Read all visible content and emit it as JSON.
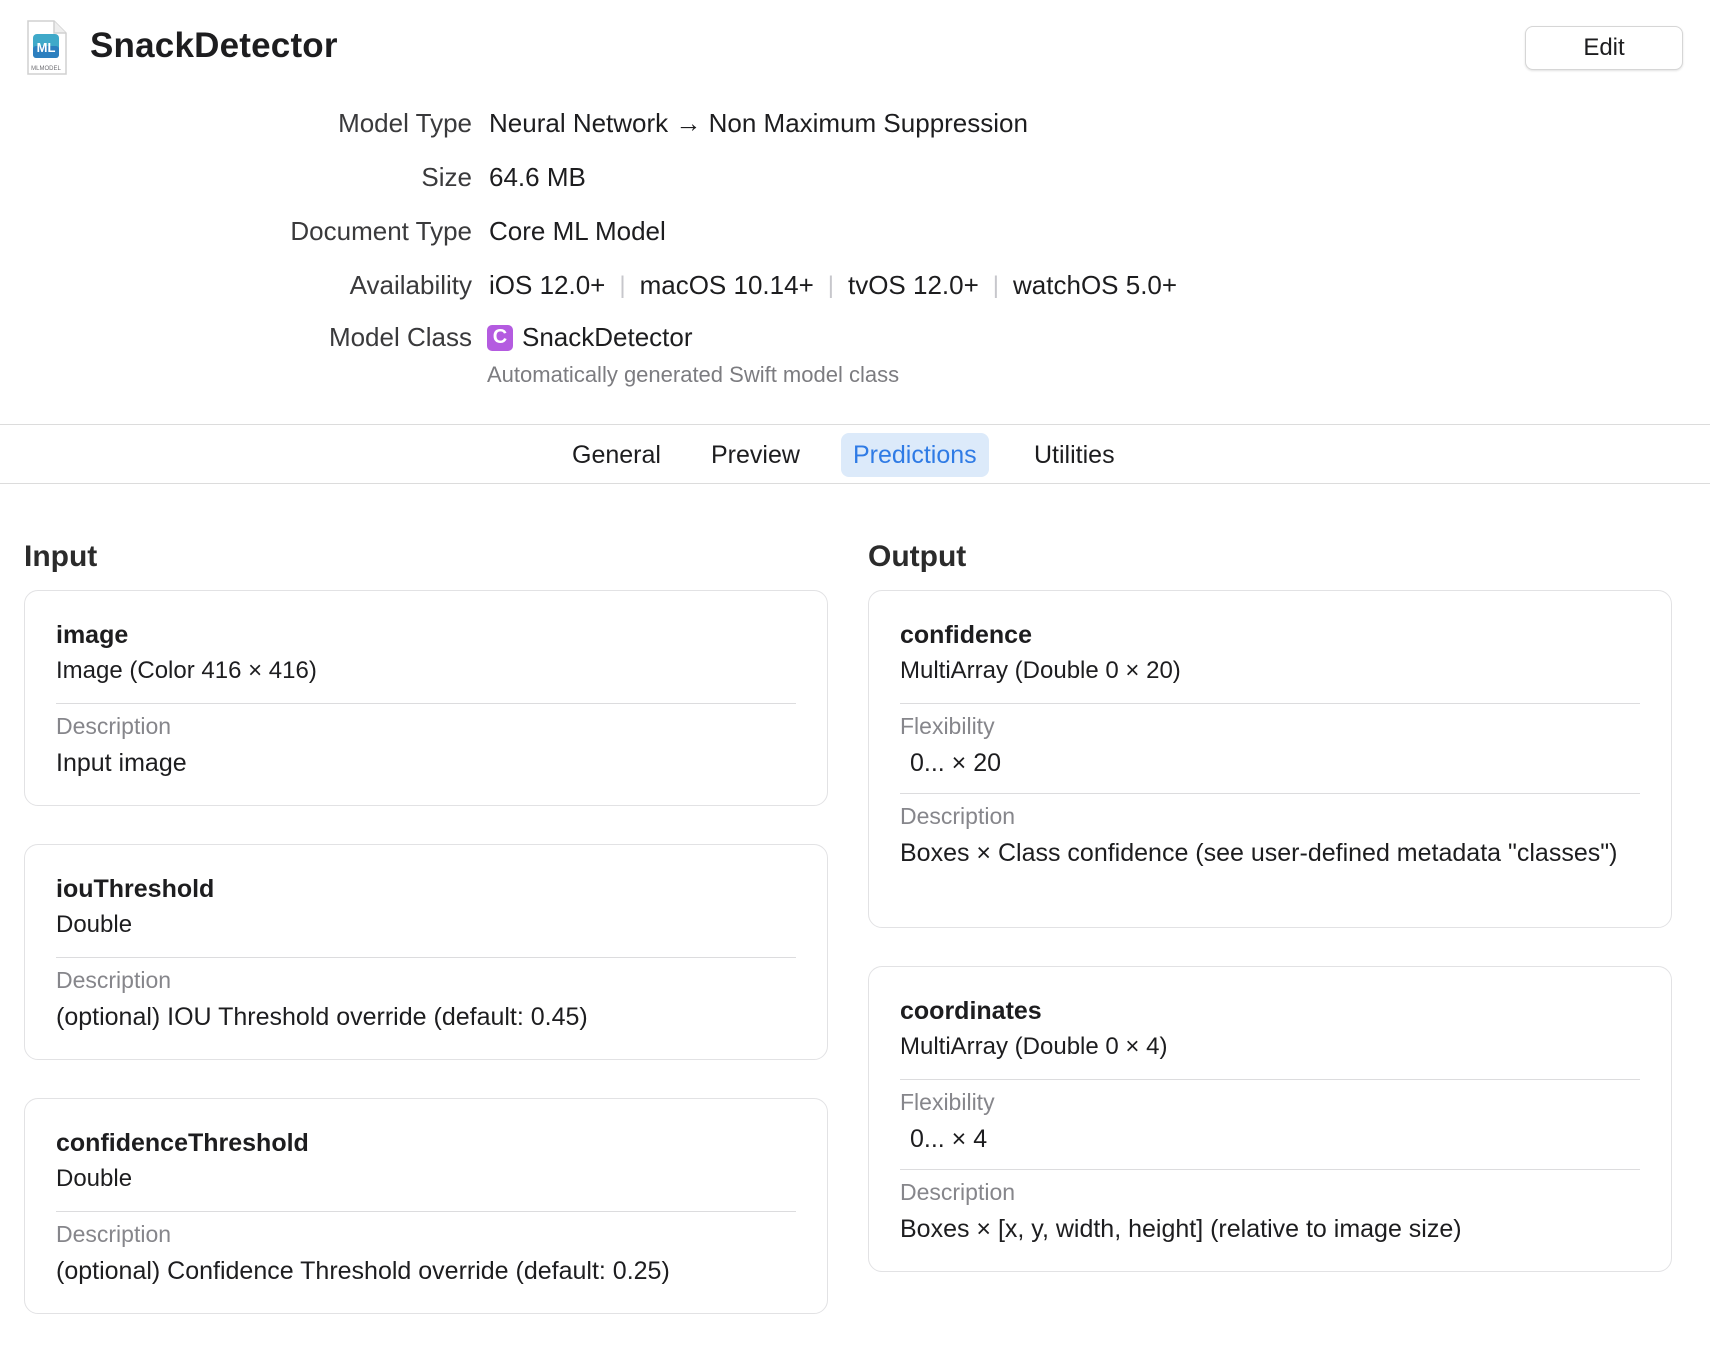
{
  "header": {
    "title": "SnackDetector",
    "file_icon_label": "MLMODEL",
    "edit_label": "Edit"
  },
  "info": {
    "model_type": {
      "label": "Model Type",
      "value": "Neural Network → Non Maximum Suppression"
    },
    "size": {
      "label": "Size",
      "value": "64.6 MB"
    },
    "document_type": {
      "label": "Document Type",
      "value": "Core ML Model"
    },
    "availability": {
      "label": "Availability",
      "values": [
        "iOS 12.0+",
        "macOS 10.14+",
        "tvOS 12.0+",
        "watchOS 5.0+"
      ]
    },
    "model_class": {
      "label": "Model Class",
      "icon_letter": "C",
      "value": "SnackDetector",
      "subtitle": "Automatically generated Swift model class"
    }
  },
  "tabs": [
    {
      "label": "General"
    },
    {
      "label": "Preview"
    },
    {
      "label": "Predictions",
      "active": true
    },
    {
      "label": "Utilities"
    }
  ],
  "input": {
    "title": "Input",
    "cards": [
      {
        "name": "image",
        "type": "Image (Color 416 × 416)",
        "description_label": "Description",
        "description": "Input image"
      },
      {
        "name": "iouThreshold",
        "type": "Double",
        "description_label": "Description",
        "description": "(optional) IOU Threshold override (default: 0.45)"
      },
      {
        "name": "confidenceThreshold",
        "type": "Double",
        "description_label": "Description",
        "description": "(optional) Confidence Threshold override (default: 0.25)"
      }
    ]
  },
  "output": {
    "title": "Output",
    "cards": [
      {
        "name": "confidence",
        "type": "MultiArray (Double 0 × 20)",
        "flexibility_label": "Flexibility",
        "flexibility": "0... × 20",
        "description_label": "Description",
        "description": "Boxes × Class confidence (see user-defined metadata \"classes\")"
      },
      {
        "name": "coordinates",
        "type": "MultiArray (Double 0 × 4)",
        "flexibility_label": "Flexibility",
        "flexibility": "0... × 4",
        "description_label": "Description",
        "description": "Boxes × [x, y, width, height] (relative to image size)"
      }
    ]
  },
  "colors": {
    "accent": "#2f7be5",
    "tab_active_bg": "#dceafa",
    "class_icon": "#b45be0"
  }
}
